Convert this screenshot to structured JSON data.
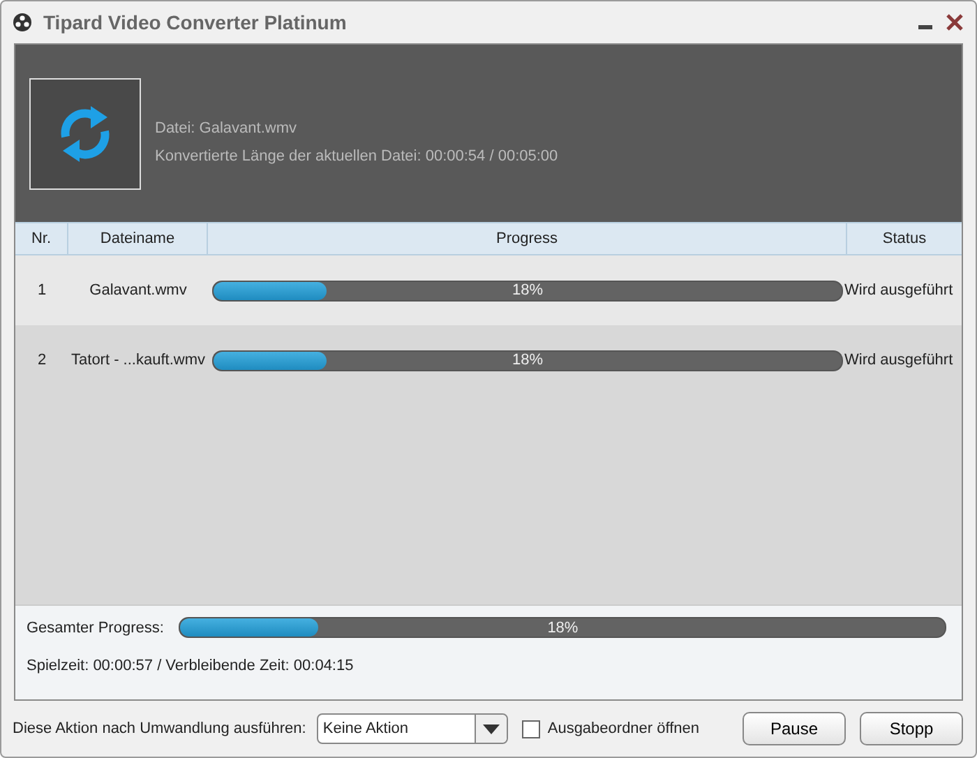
{
  "window": {
    "title": "Tipard Video Converter Platinum"
  },
  "current": {
    "file": "Datei: Galavant.wmv",
    "length": "Konvertierte Länge der aktuellen Datei: 00:00:54 / 00:05:00"
  },
  "table": {
    "columns": [
      "Nr.",
      "Dateiname",
      "Progress",
      "Status"
    ],
    "rows": [
      {
        "nr": "1",
        "name": "Galavant.wmv",
        "level": 0.18,
        "percent": "18%",
        "status": "Wird ausgeführt"
      },
      {
        "nr": "2",
        "name": "Tatort - ...kauft.wmv",
        "level": 0.18,
        "percent": "18%",
        "status": "Wird ausgeführt"
      }
    ]
  },
  "total": {
    "label": "Gesamter Progress:",
    "level": 0.18,
    "percent": "18%",
    "times": "Spielzeit: 00:00:57 / Verbleibende Zeit: 00:04:15"
  },
  "footer": {
    "action_label": "Diese Aktion nach Umwandlung ausführen:",
    "action_value": "Keine Aktion",
    "open_folder": {
      "label": "Ausgabeordner öffnen",
      "checked": false
    },
    "buttons": [
      "Pause",
      "Stopp"
    ]
  }
}
